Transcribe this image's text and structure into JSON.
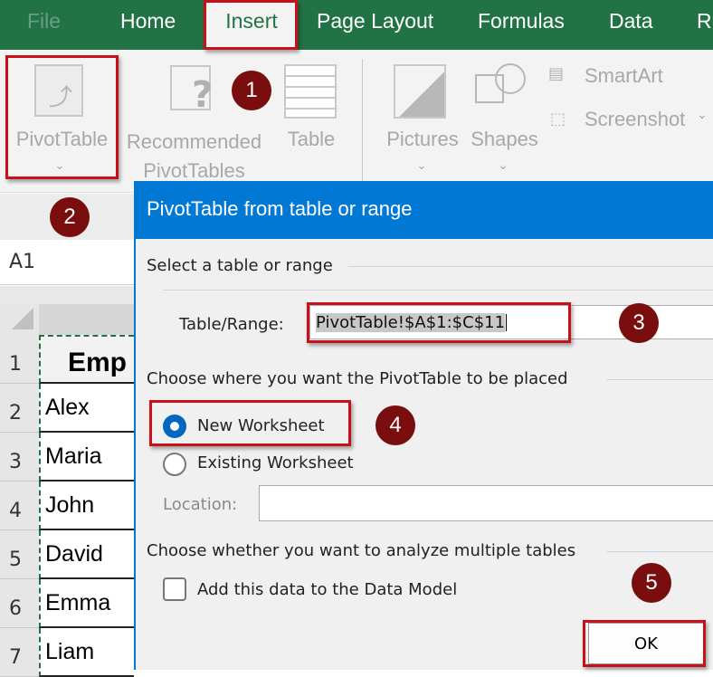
{
  "tabs": [
    {
      "label": "File"
    },
    {
      "label": "Home"
    },
    {
      "label": "Insert"
    },
    {
      "label": "Page Layout"
    },
    {
      "label": "Formulas"
    },
    {
      "label": "Data"
    },
    {
      "label": "R"
    }
  ],
  "ribbon": {
    "pivottable": "PivotTable",
    "recommended_1": "Recommended",
    "recommended_2": "PivotTables",
    "table": "Table",
    "pictures": "Pictures",
    "shapes": "Shapes",
    "smartart": "SmartArt",
    "screenshot": "Screenshot"
  },
  "namebox": "A1",
  "rows": [
    {
      "n": "1",
      "v": "Emp"
    },
    {
      "n": "2",
      "v": "Alex"
    },
    {
      "n": "3",
      "v": "Maria"
    },
    {
      "n": "4",
      "v": "John"
    },
    {
      "n": "5",
      "v": "David"
    },
    {
      "n": "6",
      "v": "Emma"
    },
    {
      "n": "7",
      "v": "Liam"
    }
  ],
  "dialog": {
    "title": "PivotTable from table or range",
    "section1": "Select a table or range",
    "range_label": "Table/Range:",
    "range_value": "PivotTable!$A$1:$C$11",
    "section2": "Choose where you want the PivotTable to be placed",
    "new_ws": "New Worksheet",
    "existing_ws": "Existing Worksheet",
    "location_label": "Location:",
    "location_value": "",
    "section3": "Choose whether you want to analyze multiple tables",
    "data_model": "Add this data to the Data Model",
    "ok": "OK",
    "new_ws_selected": true,
    "data_model_checked": false
  },
  "badges": [
    "1",
    "2",
    "3",
    "4",
    "5"
  ],
  "colors": {
    "excel_green": "#217346",
    "dialog_blue": "#0078d4",
    "highlight_red": "#c8101a",
    "badge": "#7a0d0d"
  }
}
